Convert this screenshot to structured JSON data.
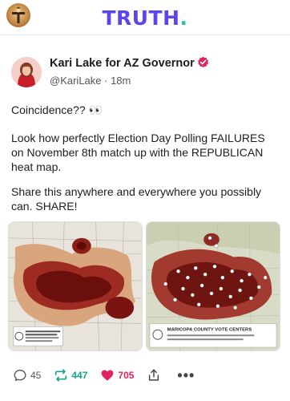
{
  "header": {
    "logo_text": "TRUTH",
    "logo_dot": "."
  },
  "post": {
    "author_name": "Kari Lake for AZ Governor",
    "handle": "@KariLake",
    "separator": " · ",
    "time": "18m",
    "paragraphs": [
      "Coincidence?? 👀",
      "Look how perfectly Election Day Polling FAILURES on November 8th match up with the REPUBLICAN heat map.",
      "Share this anywhere and everywhere you possibly can. SHARE!"
    ],
    "media": {
      "left_caption": "General Election 2020 to Ensure Republican Vote Out Density",
      "right_caption": "MARICOPA COUNTY VOTE CENTERS"
    },
    "actions": {
      "reply_count": "45",
      "retruth_count": "447",
      "like_count": "705"
    }
  },
  "colors": {
    "brand": "#5a46ee",
    "brand_accent": "#21c3a8",
    "retruth": "#17a589",
    "like": "#e0245e",
    "verified": "#e0245e"
  },
  "icons": [
    "profile-avatar-icon",
    "verified-badge-icon",
    "reply-icon",
    "retruth-icon",
    "heart-icon",
    "share-icon",
    "more-icon"
  ]
}
